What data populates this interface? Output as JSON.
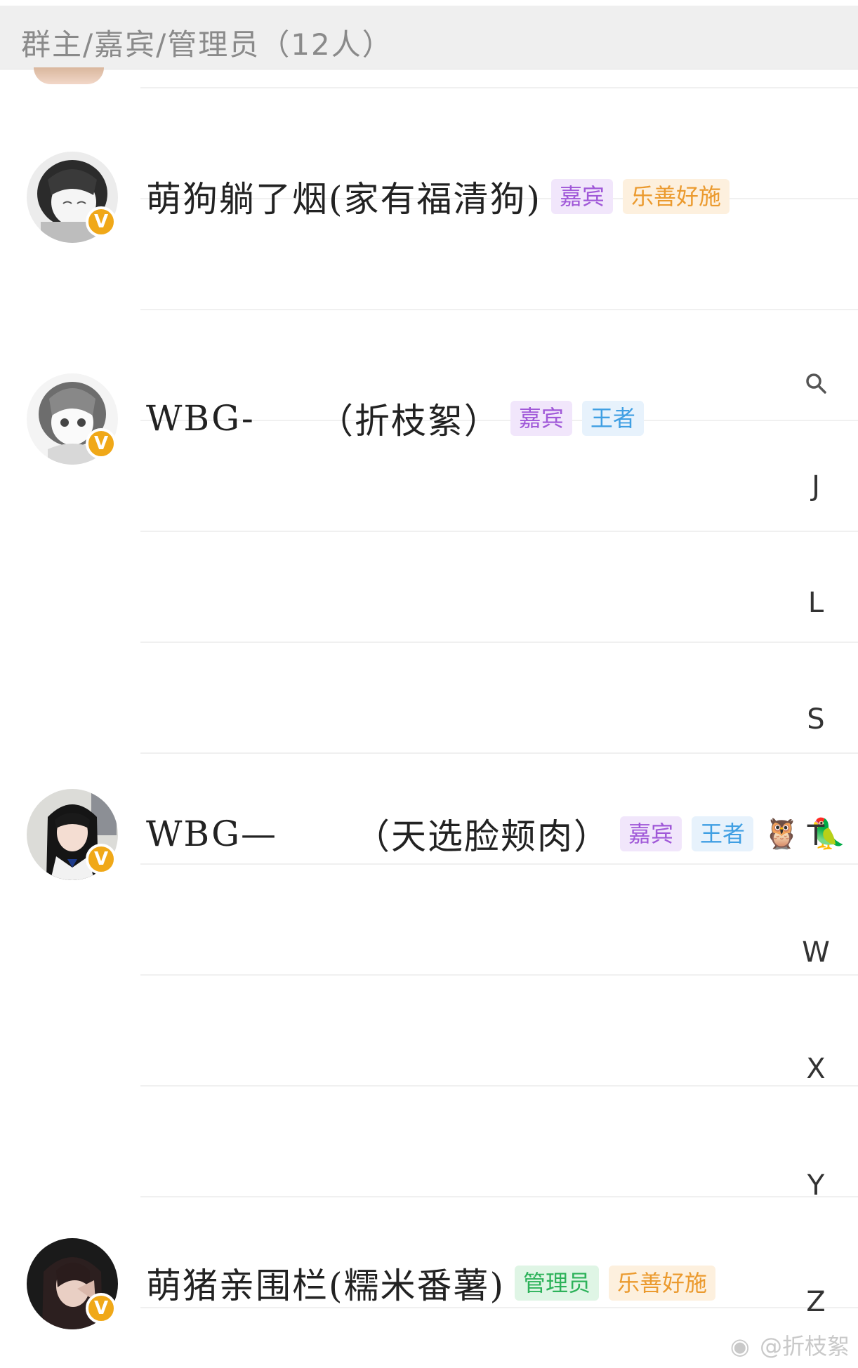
{
  "header": {
    "title": "群主/嘉宾/管理员（12人）"
  },
  "members": [
    {
      "name": "萌狗躺了烟(家有福清狗)",
      "name_prefix": "",
      "tags": [
        {
          "label": "嘉宾",
          "kind": "guest"
        },
        {
          "label": "乐善好施",
          "kind": "charity"
        }
      ],
      "verified": "V",
      "avatar_icon": "anime-girl-avatar"
    },
    {
      "name_prefix": "WBG-",
      "name": "（折枝絮）",
      "tags": [
        {
          "label": "嘉宾",
          "kind": "guest"
        },
        {
          "label": "王者",
          "kind": "king"
        }
      ],
      "verified": "V",
      "avatar_icon": "anime-girl-avatar"
    },
    {
      "name_prefix": "WBG—",
      "name": "（天选脸颊肉）",
      "tags": [
        {
          "label": "嘉宾",
          "kind": "guest"
        },
        {
          "label": "王者",
          "kind": "king"
        }
      ],
      "emojis": [
        "🦉",
        "🦜"
      ],
      "verified": "V",
      "avatar_icon": "girl-photo-avatar"
    },
    {
      "name": "萌猪亲围栏(糯米番薯)",
      "name_prefix": "",
      "tags": [
        {
          "label": "管理员",
          "kind": "admin"
        },
        {
          "label": "乐善好施",
          "kind": "charity"
        }
      ],
      "verified": "V",
      "avatar_icon": "girl-photo-avatar"
    }
  ],
  "index_bar": {
    "search_icon": "search-icon",
    "letters": [
      "J",
      "L",
      "S",
      "T",
      "W",
      "X",
      "Y",
      "Z"
    ]
  },
  "watermark": {
    "text": "@折枝絮",
    "icon": "weibo-logo-icon"
  },
  "colors": {
    "guest": "#a058d8",
    "charity": "#eb9a2e",
    "king": "#3f9fe3",
    "admin": "#2db25a",
    "verified_badge": "#f0a818"
  }
}
